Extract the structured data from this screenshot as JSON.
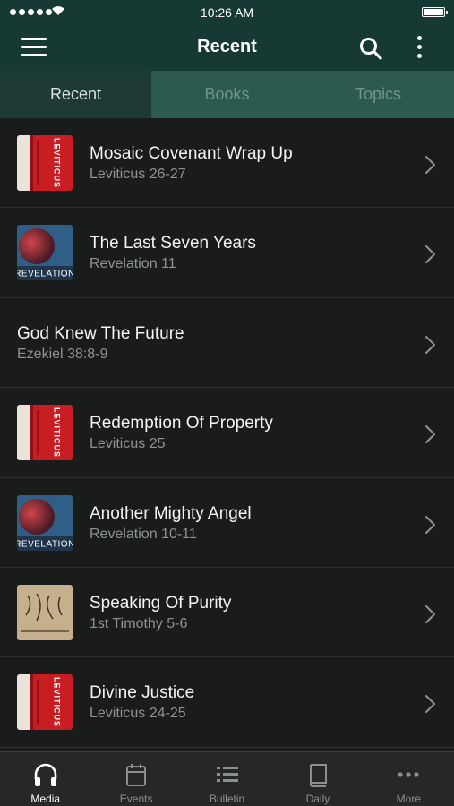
{
  "status": {
    "time": "10:26 AM"
  },
  "nav": {
    "title": "Recent",
    "menu_icon": "menu-icon",
    "search_icon": "search-icon",
    "more_icon": "more-vertical-icon"
  },
  "tabs": [
    {
      "label": "Recent",
      "active": true
    },
    {
      "label": "Books",
      "active": false
    },
    {
      "label": "Topics",
      "active": false
    }
  ],
  "items": [
    {
      "title": "Mosaic Covenant Wrap Up",
      "subtitle": "Leviticus 26-27",
      "thumb": "leviticus"
    },
    {
      "title": "The Last Seven Years",
      "subtitle": "Revelation 11",
      "thumb": "revelation"
    },
    {
      "title": "God Knew The Future",
      "subtitle": "Ezekiel 38:8-9",
      "thumb": ""
    },
    {
      "title": "Redemption Of Property",
      "subtitle": "Leviticus 25",
      "thumb": "leviticus"
    },
    {
      "title": "Another Mighty Angel",
      "subtitle": "Revelation 10-11",
      "thumb": "revelation"
    },
    {
      "title": "Speaking Of Purity",
      "subtitle": "1st Timothy 5-6",
      "thumb": "timothy"
    },
    {
      "title": "Divine Justice",
      "subtitle": "Leviticus 24-25",
      "thumb": "leviticus"
    }
  ],
  "thumb_text": {
    "leviticus": "LEVITICUS",
    "revelation": "REVELATION"
  },
  "tabbar": [
    {
      "label": "Media",
      "icon": "headphones-icon",
      "active": true
    },
    {
      "label": "Events",
      "icon": "calendar-icon",
      "active": false
    },
    {
      "label": "Bulletin",
      "icon": "list-icon",
      "active": false
    },
    {
      "label": "Daily",
      "icon": "book-icon",
      "active": false
    },
    {
      "label": "More",
      "icon": "more-horizontal-icon",
      "active": false
    }
  ],
  "colors": {
    "accent": "#163a33",
    "tab_bg": "#2c5a50",
    "tab_active": "#1e3a35",
    "list_bg": "#1a1c1c"
  }
}
